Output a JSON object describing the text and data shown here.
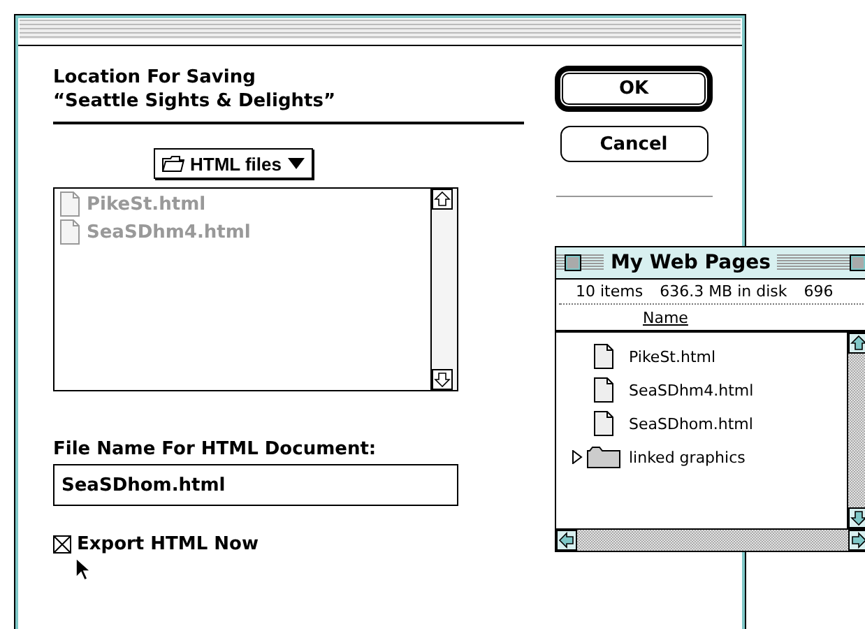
{
  "dialog": {
    "heading_lines": [
      "Location For Saving",
      "“Seattle Sights & Delights”"
    ],
    "folder_popup": "HTML files",
    "file_list": [
      {
        "name": "PikeSt.html",
        "disabled": true
      },
      {
        "name": "SeaSDhm4.html",
        "disabled": true
      }
    ],
    "filename_label": "File Name For HTML Document:",
    "filename_value": "SeaSDhom.html",
    "export_checkbox": {
      "label": "Export HTML Now",
      "checked": true
    },
    "buttons": [
      {
        "label": "OK",
        "default": true
      },
      {
        "label": "Cancel",
        "default": false
      }
    ]
  },
  "finder": {
    "title": "My Web Pages",
    "info": [
      "10 items",
      "636.3 MB in disk",
      "696"
    ],
    "column": "Name",
    "items": [
      {
        "name": "PikeSt.html",
        "kind": "file"
      },
      {
        "name": "SeaSDhm4.html",
        "kind": "file"
      },
      {
        "name": "SeaSDhom.html",
        "kind": "file"
      },
      {
        "name": "linked graphics",
        "kind": "folder",
        "expanded": false
      }
    ]
  }
}
